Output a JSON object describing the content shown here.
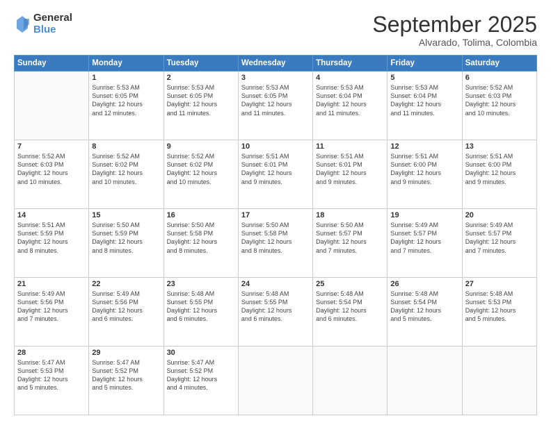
{
  "header": {
    "logo_general": "General",
    "logo_blue": "Blue",
    "month_year": "September 2025",
    "location": "Alvarado, Tolima, Colombia"
  },
  "weekdays": [
    "Sunday",
    "Monday",
    "Tuesday",
    "Wednesday",
    "Thursday",
    "Friday",
    "Saturday"
  ],
  "weeks": [
    [
      {
        "day": "",
        "info": ""
      },
      {
        "day": "1",
        "info": "Sunrise: 5:53 AM\nSunset: 6:05 PM\nDaylight: 12 hours\nand 12 minutes."
      },
      {
        "day": "2",
        "info": "Sunrise: 5:53 AM\nSunset: 6:05 PM\nDaylight: 12 hours\nand 11 minutes."
      },
      {
        "day": "3",
        "info": "Sunrise: 5:53 AM\nSunset: 6:05 PM\nDaylight: 12 hours\nand 11 minutes."
      },
      {
        "day": "4",
        "info": "Sunrise: 5:53 AM\nSunset: 6:04 PM\nDaylight: 12 hours\nand 11 minutes."
      },
      {
        "day": "5",
        "info": "Sunrise: 5:53 AM\nSunset: 6:04 PM\nDaylight: 12 hours\nand 11 minutes."
      },
      {
        "day": "6",
        "info": "Sunrise: 5:52 AM\nSunset: 6:03 PM\nDaylight: 12 hours\nand 10 minutes."
      }
    ],
    [
      {
        "day": "7",
        "info": "Sunrise: 5:52 AM\nSunset: 6:03 PM\nDaylight: 12 hours\nand 10 minutes."
      },
      {
        "day": "8",
        "info": "Sunrise: 5:52 AM\nSunset: 6:02 PM\nDaylight: 12 hours\nand 10 minutes."
      },
      {
        "day": "9",
        "info": "Sunrise: 5:52 AM\nSunset: 6:02 PM\nDaylight: 12 hours\nand 10 minutes."
      },
      {
        "day": "10",
        "info": "Sunrise: 5:51 AM\nSunset: 6:01 PM\nDaylight: 12 hours\nand 9 minutes."
      },
      {
        "day": "11",
        "info": "Sunrise: 5:51 AM\nSunset: 6:01 PM\nDaylight: 12 hours\nand 9 minutes."
      },
      {
        "day": "12",
        "info": "Sunrise: 5:51 AM\nSunset: 6:00 PM\nDaylight: 12 hours\nand 9 minutes."
      },
      {
        "day": "13",
        "info": "Sunrise: 5:51 AM\nSunset: 6:00 PM\nDaylight: 12 hours\nand 9 minutes."
      }
    ],
    [
      {
        "day": "14",
        "info": "Sunrise: 5:51 AM\nSunset: 5:59 PM\nDaylight: 12 hours\nand 8 minutes."
      },
      {
        "day": "15",
        "info": "Sunrise: 5:50 AM\nSunset: 5:59 PM\nDaylight: 12 hours\nand 8 minutes."
      },
      {
        "day": "16",
        "info": "Sunrise: 5:50 AM\nSunset: 5:58 PM\nDaylight: 12 hours\nand 8 minutes."
      },
      {
        "day": "17",
        "info": "Sunrise: 5:50 AM\nSunset: 5:58 PM\nDaylight: 12 hours\nand 8 minutes."
      },
      {
        "day": "18",
        "info": "Sunrise: 5:50 AM\nSunset: 5:57 PM\nDaylight: 12 hours\nand 7 minutes."
      },
      {
        "day": "19",
        "info": "Sunrise: 5:49 AM\nSunset: 5:57 PM\nDaylight: 12 hours\nand 7 minutes."
      },
      {
        "day": "20",
        "info": "Sunrise: 5:49 AM\nSunset: 5:57 PM\nDaylight: 12 hours\nand 7 minutes."
      }
    ],
    [
      {
        "day": "21",
        "info": "Sunrise: 5:49 AM\nSunset: 5:56 PM\nDaylight: 12 hours\nand 7 minutes."
      },
      {
        "day": "22",
        "info": "Sunrise: 5:49 AM\nSunset: 5:56 PM\nDaylight: 12 hours\nand 6 minutes."
      },
      {
        "day": "23",
        "info": "Sunrise: 5:48 AM\nSunset: 5:55 PM\nDaylight: 12 hours\nand 6 minutes."
      },
      {
        "day": "24",
        "info": "Sunrise: 5:48 AM\nSunset: 5:55 PM\nDaylight: 12 hours\nand 6 minutes."
      },
      {
        "day": "25",
        "info": "Sunrise: 5:48 AM\nSunset: 5:54 PM\nDaylight: 12 hours\nand 6 minutes."
      },
      {
        "day": "26",
        "info": "Sunrise: 5:48 AM\nSunset: 5:54 PM\nDaylight: 12 hours\nand 5 minutes."
      },
      {
        "day": "27",
        "info": "Sunrise: 5:48 AM\nSunset: 5:53 PM\nDaylight: 12 hours\nand 5 minutes."
      }
    ],
    [
      {
        "day": "28",
        "info": "Sunrise: 5:47 AM\nSunset: 5:53 PM\nDaylight: 12 hours\nand 5 minutes."
      },
      {
        "day": "29",
        "info": "Sunrise: 5:47 AM\nSunset: 5:52 PM\nDaylight: 12 hours\nand 5 minutes."
      },
      {
        "day": "30",
        "info": "Sunrise: 5:47 AM\nSunset: 5:52 PM\nDaylight: 12 hours\nand 4 minutes."
      },
      {
        "day": "",
        "info": ""
      },
      {
        "day": "",
        "info": ""
      },
      {
        "day": "",
        "info": ""
      },
      {
        "day": "",
        "info": ""
      }
    ]
  ]
}
